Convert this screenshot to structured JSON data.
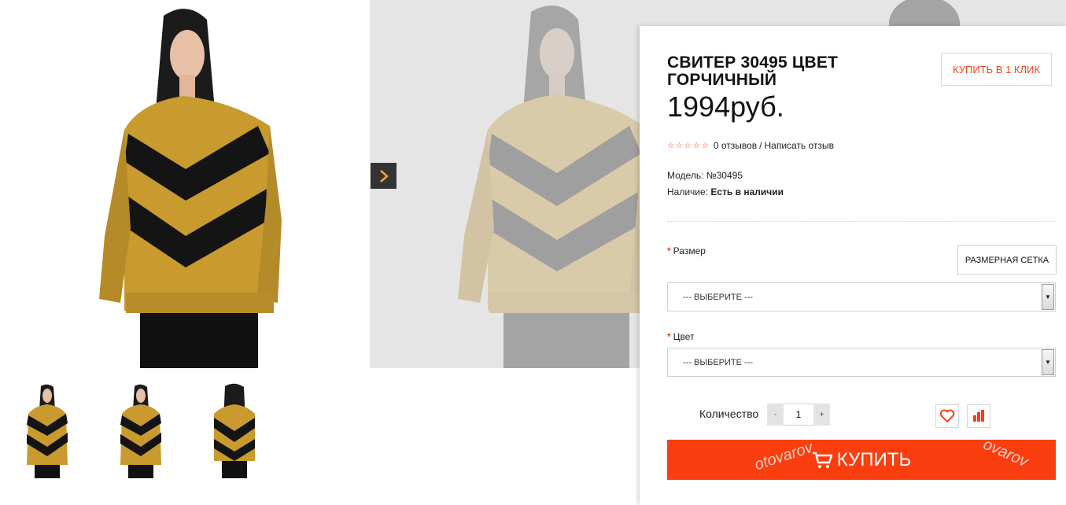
{
  "product": {
    "title": "СВИТЕР 30495 ЦВЕТ ГОРЧИЧНЫЙ",
    "price": "1994руб.",
    "one_click_label": "КУПИТЬ В 1 КЛИК",
    "rating_stars": "☆☆☆☆☆",
    "reviews_text": "0 отзывов",
    "rating_separator": "/",
    "write_review_text": "Написать отзыв",
    "model_label": "Модель:",
    "model_value": "№30495",
    "availability_label": "Наличие:",
    "availability_value": "Есть в наличии"
  },
  "options": {
    "size_label": "Размер",
    "size_grid_button": "РАЗМЕРНАЯ СЕТКА",
    "size_select_value": "--- ВЫБЕРИТЕ ---",
    "color_label": "Цвет",
    "color_select_value": "--- ВЫБЕРИТЕ ---",
    "required_marker": "*"
  },
  "quantity": {
    "label": "Количество",
    "value": "1",
    "minus": "-",
    "plus": "+"
  },
  "buy": {
    "label": "КУПИТЬ",
    "watermark_left": "otovarov",
    "watermark_right": "ovarov"
  },
  "colors": {
    "accent": "#fa3e0f",
    "sweater_mustard": "#c99a2e",
    "sweater_black": "#111111"
  },
  "icons": {
    "arrow": "chevron-right-icon",
    "wishlist": "heart-icon",
    "compare": "compare-icon",
    "cart": "cart-icon"
  }
}
